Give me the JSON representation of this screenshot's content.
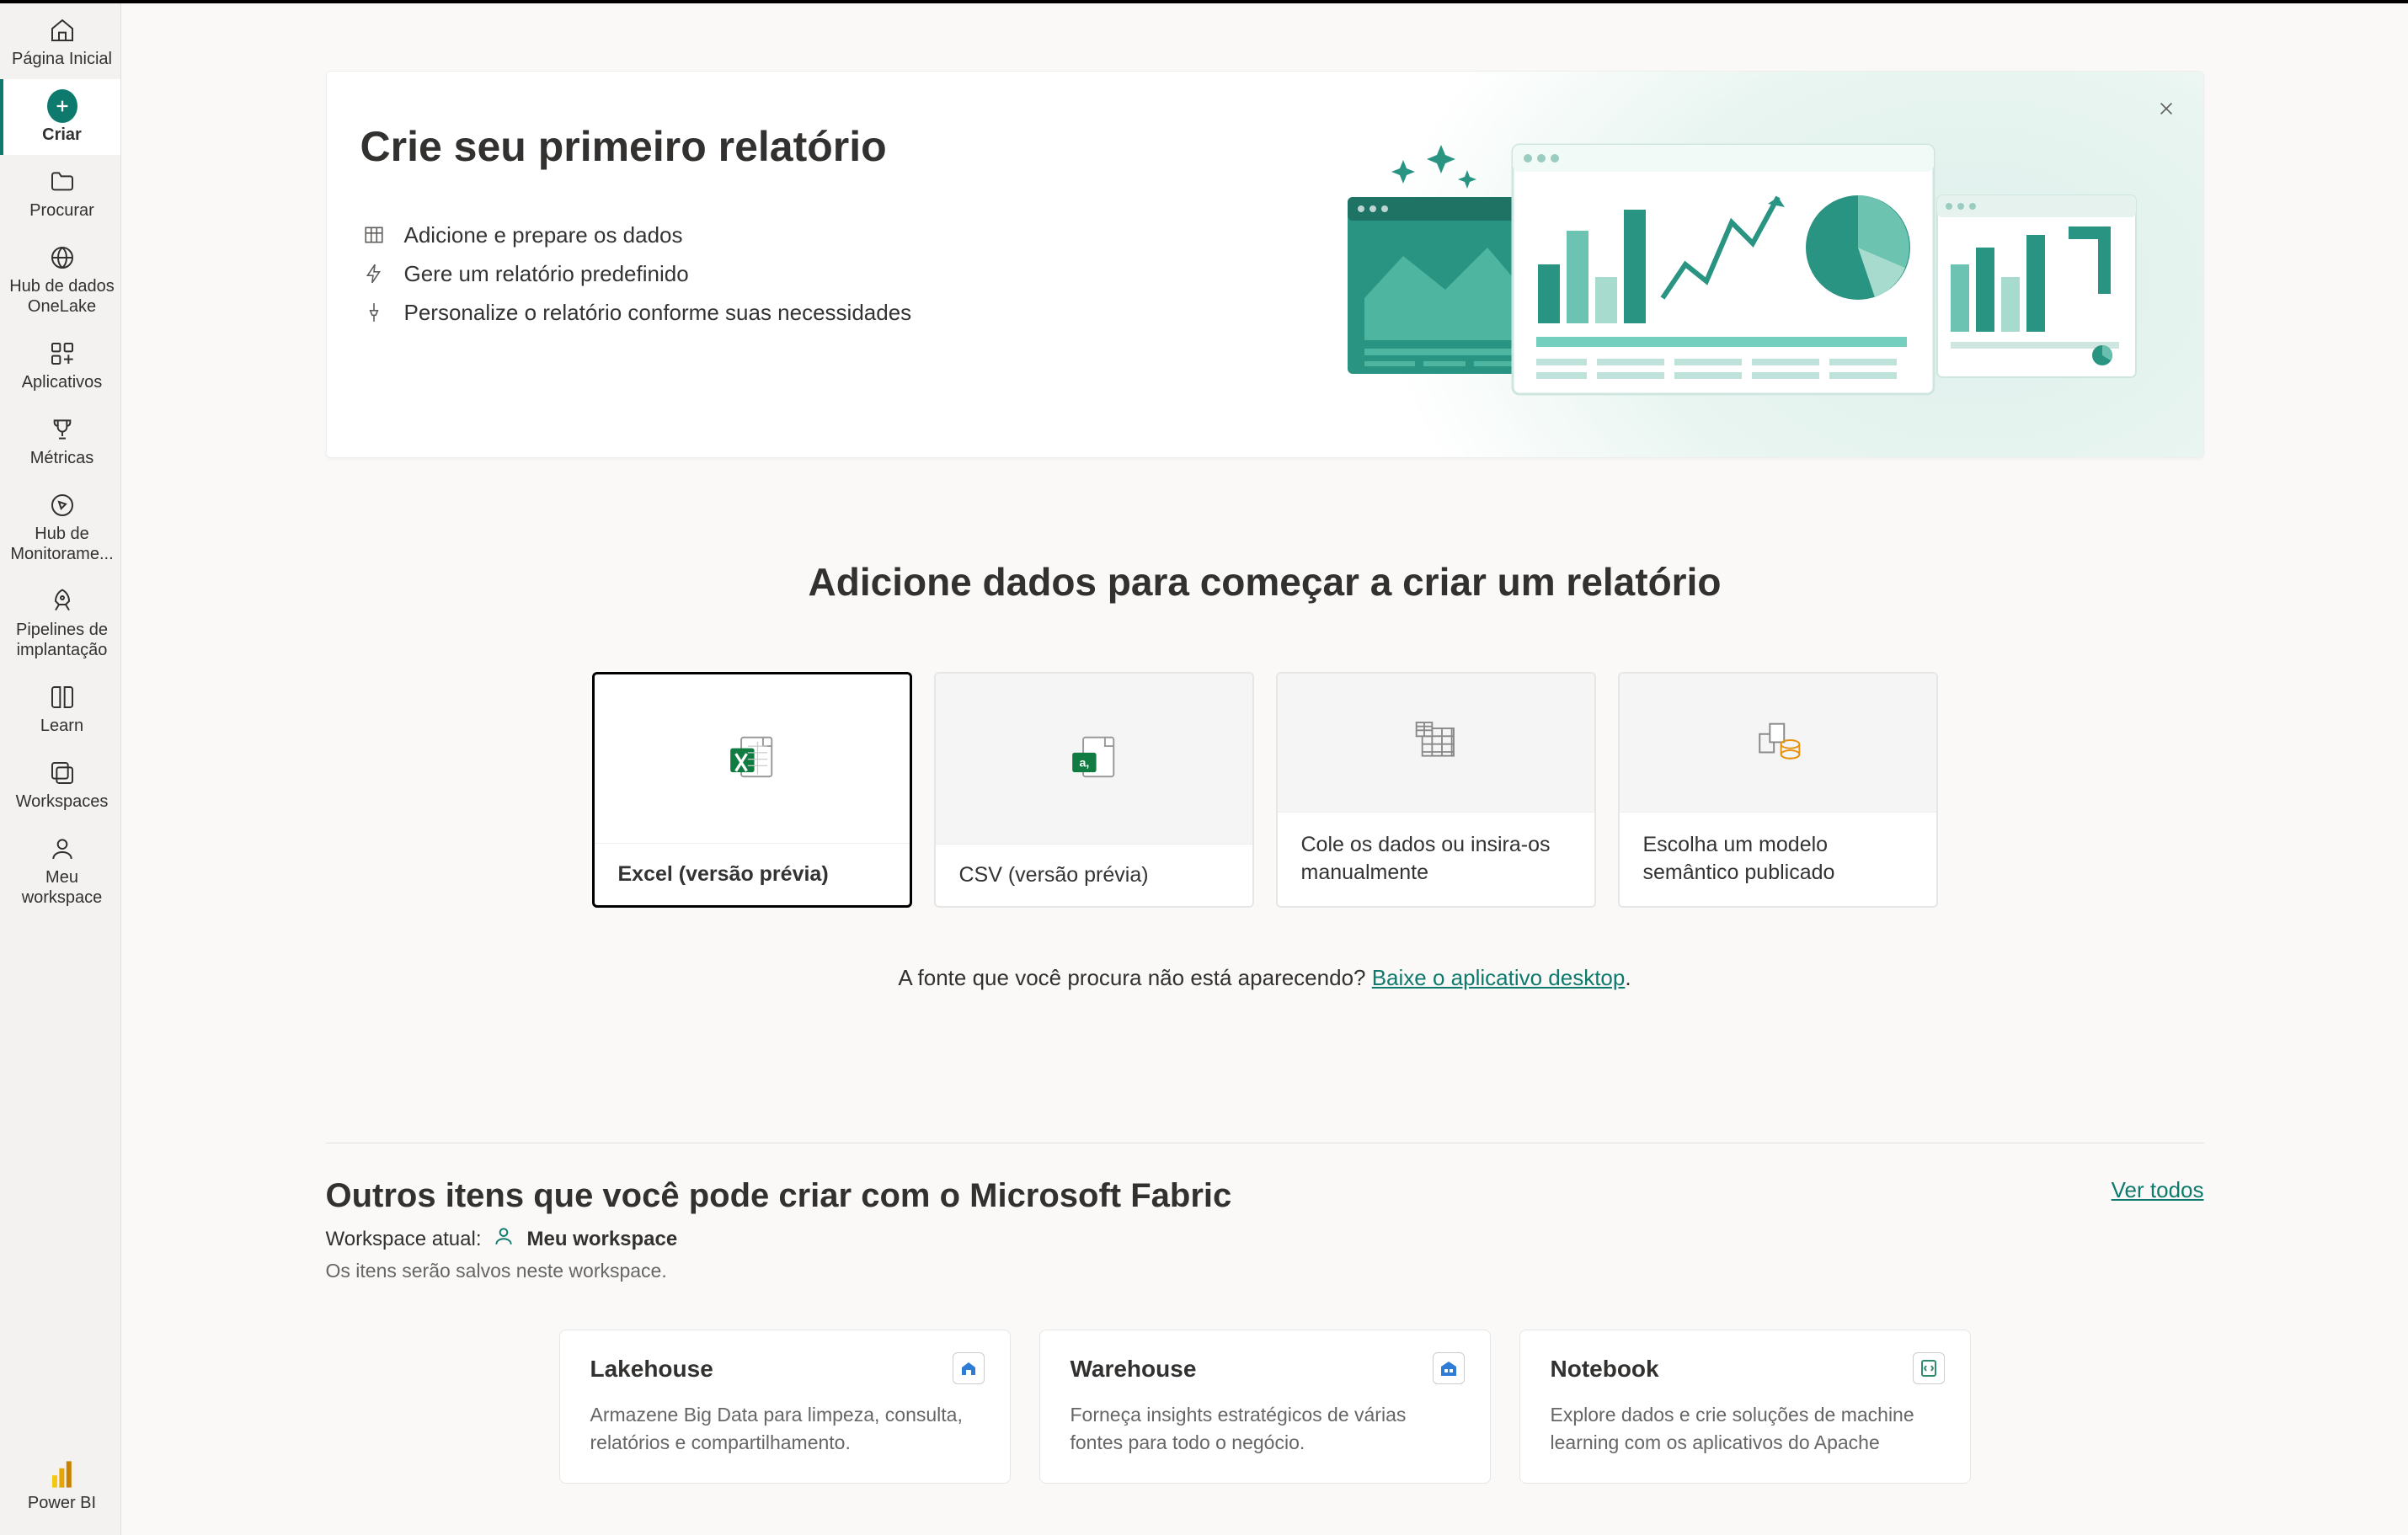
{
  "sidebar": {
    "items": [
      {
        "label": "Página Inicial",
        "icon": "home"
      },
      {
        "label": "Criar",
        "icon": "plus-circle",
        "selected": true
      },
      {
        "label": "Procurar",
        "icon": "folder"
      },
      {
        "label": "Hub de dados OneLake",
        "icon": "onelake"
      },
      {
        "label": "Aplicativos",
        "icon": "apps"
      },
      {
        "label": "Métricas",
        "icon": "trophy"
      },
      {
        "label": "Hub de Monitorame...",
        "icon": "compass"
      },
      {
        "label": "Pipelines de implantação",
        "icon": "rocket"
      },
      {
        "label": "Learn",
        "icon": "book"
      },
      {
        "label": "Workspaces",
        "icon": "workspaces"
      },
      {
        "label": "Meu workspace",
        "icon": "person"
      }
    ],
    "footer": {
      "label": "Power BI",
      "icon": "powerbi"
    }
  },
  "hero": {
    "title": "Crie seu primeiro relatório",
    "bullets": [
      {
        "icon": "table",
        "text": "Adicione e prepare os dados"
      },
      {
        "icon": "bolt",
        "text": "Gere um relatório predefinido"
      },
      {
        "icon": "pin",
        "text": "Personalize o relatório conforme suas necessidades"
      }
    ]
  },
  "section_title": "Adicione dados para começar a criar um relatório",
  "data_sources": [
    {
      "label": "Excel (versão prévia)",
      "icon": "excel",
      "selected": true
    },
    {
      "label": "CSV (versão prévia)",
      "icon": "csv"
    },
    {
      "label": "Cole os dados ou insira-os manualmente",
      "icon": "table-grid"
    },
    {
      "label": "Escolha um modelo semântico publicado",
      "icon": "model"
    }
  ],
  "help": {
    "text": "A fonte que você procura não está aparecendo? ",
    "link_text": "Baixe o aplicativo desktop"
  },
  "fabric": {
    "title": "Outros itens que você pode criar com o Microsoft Fabric",
    "ws_label": "Workspace atual:",
    "ws_name": "Meu workspace",
    "hint": "Os itens serão salvos neste workspace.",
    "see_all": "Ver todos",
    "cards": [
      {
        "title": "Lakehouse",
        "desc": "Armazene Big Data para limpeza, consulta, relatórios e compartilhamento.",
        "badge": "lakehouse"
      },
      {
        "title": "Warehouse",
        "desc": "Forneça insights estratégicos de várias fontes para todo o negócio.",
        "badge": "warehouse"
      },
      {
        "title": "Notebook",
        "desc": "Explore dados e crie soluções de machine learning com os aplicativos do Apache",
        "badge": "notebook"
      }
    ]
  }
}
